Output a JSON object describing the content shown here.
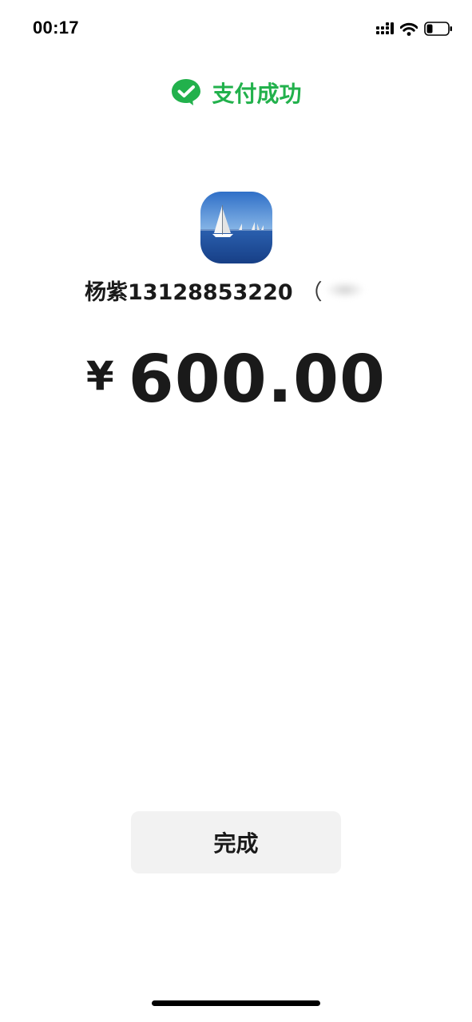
{
  "status_bar": {
    "time": "00:17",
    "icons": [
      "signal-icon",
      "wifi-icon",
      "battery-icon"
    ]
  },
  "header": {
    "title": "支付成功",
    "icon": "wechat-pay-check-icon",
    "accent_color": "#22b14c"
  },
  "payee": {
    "avatar": "sailboat-avatar",
    "name": "杨紫13128853220",
    "paren": "（"
  },
  "payment": {
    "currency_symbol": "¥",
    "amount": "600.00"
  },
  "actions": {
    "done_label": "完成"
  }
}
